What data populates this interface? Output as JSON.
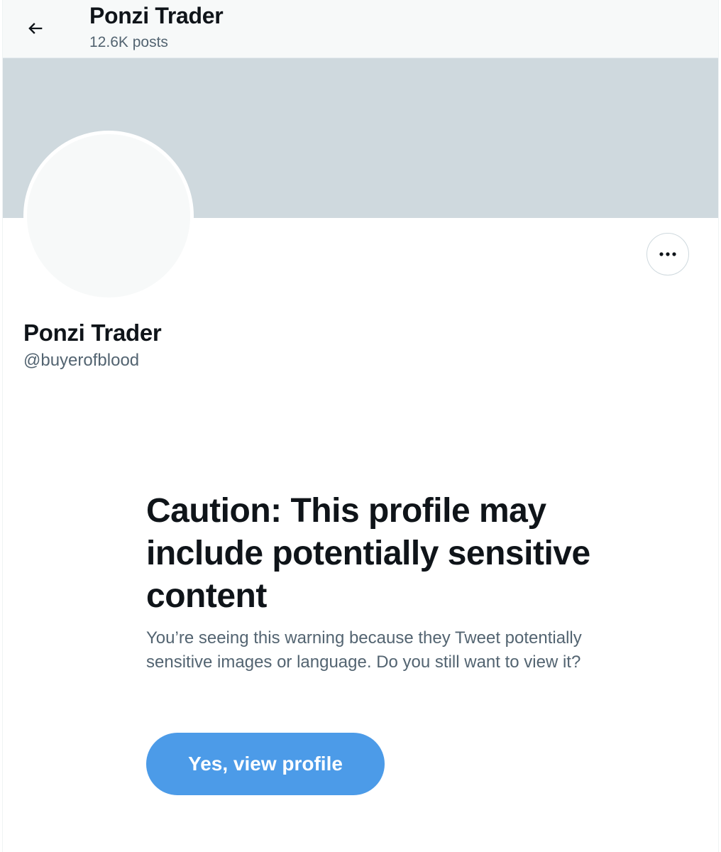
{
  "header": {
    "title": "Ponzi Trader",
    "post_count": "12.6K posts",
    "back_icon": "arrow-left-icon"
  },
  "profile": {
    "display_name": "Ponzi Trader",
    "handle": "@buyerofblood",
    "more_icon": "ellipsis-icon"
  },
  "warning": {
    "title": "Caution: This profile may include potentially sensitive content",
    "body": "You’re seeing this warning because they Tweet potentially sensitive images or language. Do you still want to view it?",
    "button_label": "Yes, view profile"
  },
  "colors": {
    "accent": "#4c9be8",
    "banner": "#cfd9de",
    "muted_text": "#536471",
    "primary_text": "#0f1419"
  }
}
